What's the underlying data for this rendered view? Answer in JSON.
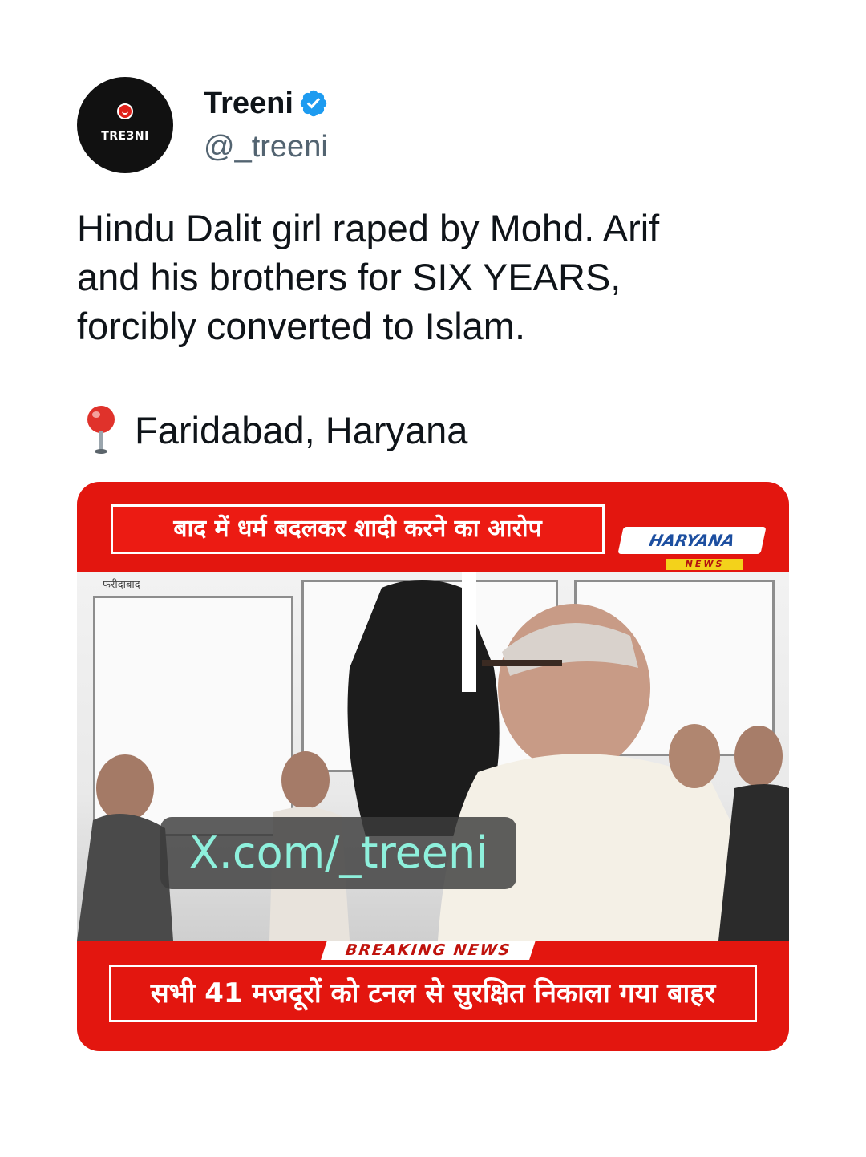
{
  "author": {
    "display_name": "Treeni",
    "handle": "@_treeni",
    "verified": true,
    "avatar_text": "TRE3NI",
    "avatar_bg": "#111111",
    "avatar_accent": "#e0221b",
    "verified_color": "#1d9bf0"
  },
  "tweet": {
    "text_lines": [
      "Hindu Dalit girl raped by Mohd. Arif",
      "and his brothers for SIX YEARS,",
      "forcibly converted to Islam."
    ],
    "location_icon": "round-pushpin-icon",
    "location": "Faridabad, Haryana"
  },
  "media": {
    "top_headline": "बाद में धर्म बदलकर शादी करने का आरोप",
    "channel_name": "HARYANA",
    "channel_sub": "NEWS",
    "place_label": "फरीदाबाद",
    "watermark": "X.com/_treeni",
    "breaking_tag": "BREAKING NEWS",
    "bottom_headline": "सभी 41 मजदूरों को टनल से सुरक्षित निकाला गया बाहर",
    "band_color": "#e3160f"
  }
}
